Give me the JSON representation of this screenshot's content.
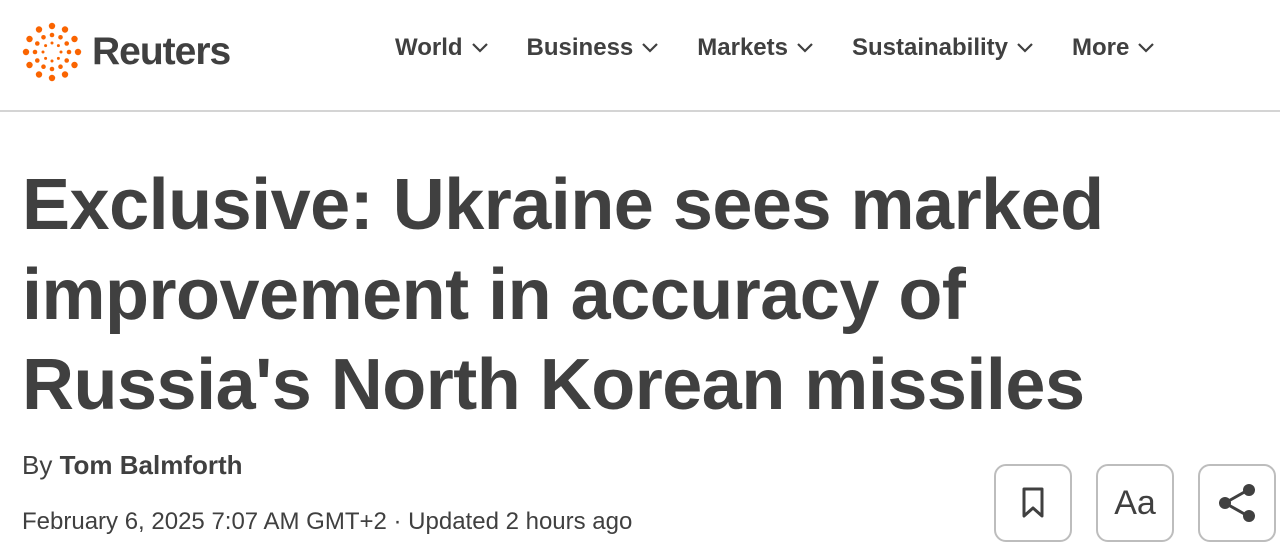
{
  "brand": {
    "name": "Reuters",
    "accent": "#fa6400"
  },
  "nav": {
    "items": [
      {
        "label": "World",
        "icon": "chevron-down-icon"
      },
      {
        "label": "Business",
        "icon": "chevron-down-icon"
      },
      {
        "label": "Markets",
        "icon": "chevron-down-icon"
      },
      {
        "label": "Sustainability",
        "icon": "chevron-down-icon"
      },
      {
        "label": "More",
        "icon": "chevron-down-icon"
      }
    ]
  },
  "article": {
    "headline": "Exclusive: Ukraine sees marked improvement in accuracy of Russia's North Korean missiles",
    "byline_prefix": "By",
    "author": "Tom Balmforth",
    "dateline": "February 6, 2025 7:07 AM GMT+2 · Updated 2 hours ago"
  },
  "tools": {
    "bookmark_icon": "bookmark-icon",
    "font_size_label": "Aa",
    "share_icon": "share-icon"
  },
  "colors": {
    "text": "#404040",
    "border": "#bdbdbd",
    "divider": "#d4d4d4"
  }
}
